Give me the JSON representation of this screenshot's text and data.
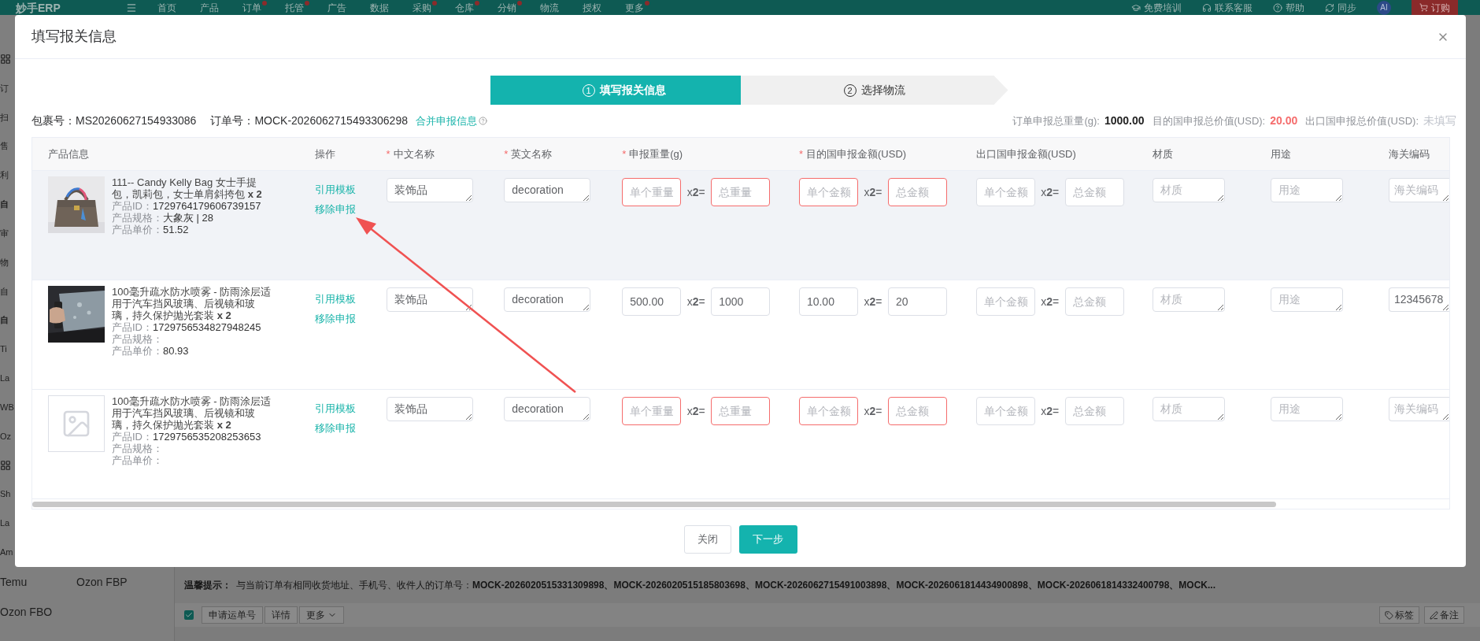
{
  "nav": {
    "logo": "妙手ERP",
    "items": [
      {
        "label": "首页",
        "dot": false
      },
      {
        "label": "产品",
        "dot": false
      },
      {
        "label": "订单",
        "dot": true
      },
      {
        "label": "托管",
        "dot": true
      },
      {
        "label": "广告",
        "dot": false
      },
      {
        "label": "数据",
        "dot": false
      },
      {
        "label": "采购",
        "dot": true
      },
      {
        "label": "仓库",
        "dot": true
      },
      {
        "label": "分销",
        "dot": true
      },
      {
        "label": "物流",
        "dot": false
      },
      {
        "label": "授权",
        "dot": false
      },
      {
        "label": "更多",
        "dot": true
      }
    ],
    "right": [
      "免费培训",
      "联系客服",
      "帮助",
      "同步"
    ],
    "avatar": "AI",
    "order_button": "订购"
  },
  "sidebar": {
    "fragments": [
      {
        "kind": "icon"
      },
      {
        "kind": "text",
        "text": "订",
        "bold": false
      },
      {
        "kind": "text",
        "text": "扫",
        "bold": false
      },
      {
        "kind": "text",
        "text": "售",
        "bold": false
      },
      {
        "kind": "text",
        "text": "利",
        "bold": false
      },
      {
        "kind": "text",
        "text": "自",
        "bold": true
      },
      {
        "kind": "text",
        "text": "审",
        "bold": false
      },
      {
        "kind": "text",
        "text": "物",
        "bold": false
      },
      {
        "kind": "text",
        "text": "自",
        "bold": false
      },
      {
        "kind": "text",
        "text": "自",
        "bold": true
      },
      {
        "kind": "text",
        "text": "Ti",
        "bold": false
      },
      {
        "kind": "text",
        "text": "La",
        "bold": false
      },
      {
        "kind": "text",
        "text": "WB",
        "bold": false
      },
      {
        "kind": "text",
        "text": "Oz",
        "bold": false
      },
      {
        "kind": "icon"
      },
      {
        "kind": "text",
        "text": "Sh",
        "bold": false
      },
      {
        "kind": "text",
        "text": "La",
        "bold": false
      },
      {
        "kind": "text",
        "text": "Am",
        "bold": false
      }
    ],
    "rows": [
      [
        "Temu",
        "Ozon FBP"
      ],
      [
        "Ozon FBO"
      ]
    ]
  },
  "dialog": {
    "title": "填写报关信息",
    "steps": [
      {
        "number": "1",
        "label": "填写报关信息",
        "selected": true
      },
      {
        "number": "2",
        "label": "选择物流",
        "selected": false
      }
    ],
    "package_label": "包裹号：",
    "package_no": "MS20260627154933086",
    "order_label": "订单号：",
    "order_no": "MOCK-2026062715493306298",
    "merge_link": "合并申报信息",
    "totals": [
      {
        "label": "订单申报总重量(g):",
        "value": "1000.00",
        "kind": "strong"
      },
      {
        "label": "目的国申报总价值(USD):",
        "value": "20.00",
        "kind": "alert"
      },
      {
        "label": "出口国申报总价值(USD):",
        "value": "未填写",
        "kind": "muted"
      }
    ],
    "columns": [
      {
        "label": "产品信息"
      },
      {
        "label": "操作"
      },
      {
        "label": "中文名称",
        "required_mark": "*"
      },
      {
        "label": "英文名称",
        "required_mark": "*"
      },
      {
        "label": "申报重量(g)",
        "required_mark": "*"
      },
      {
        "label": "目的国申报金额(USD)",
        "required_mark": "*"
      },
      {
        "label": "出口国申报金额(USD)"
      },
      {
        "label": "材质"
      },
      {
        "label": "用途"
      },
      {
        "label": "海关编码"
      }
    ],
    "rows": [
      {
        "highlighted": true,
        "image": {
          "kind": "picture"
        },
        "title": "111-- Candy Kelly Bag 女士手提包，凯莉包，女士单肩斜挎包 **x 2**",
        "product_id_label": "产品ID：",
        "product_id": "1729764179606739157",
        "spec_label": "产品规格：",
        "spec": "大象灰 | 28",
        "price_label": "产品单价：",
        "price": "51.52",
        "actions": [
          "引用模板",
          "移除申报"
        ],
        "chinese_name": {
          "value": "装饰品"
        },
        "english_name": {
          "value": "decoration"
        },
        "weight": {
          "unit": {
            "placeholder": "单个重量"
          },
          "multiplier": "x**2**=",
          "total": {
            "placeholder": "总重量"
          },
          "invalid": true
        },
        "destination_amount": {
          "unit": {
            "placeholder": "单个金额"
          },
          "multiplier": "x**2**=",
          "total": {
            "placeholder": "总金额"
          },
          "invalid": true
        },
        "export_amount": {
          "unit": {
            "placeholder": "单个金额"
          },
          "multiplier": "x**2**=",
          "total": {
            "placeholder": "总金额"
          },
          "invalid": false
        },
        "material": {
          "placeholder": "材质"
        },
        "usage": {
          "placeholder": "用途"
        },
        "customs_code": {
          "placeholder": "海关编码"
        }
      },
      {
        "highlighted": false,
        "image": {
          "kind": "picture"
        },
        "title": "100毫升疏水防水喷雾 - 防雨涂层适用于汽车挡风玻璃、后视镜和玻璃，持久保护抛光套装 **x 2**",
        "product_id_label": "产品ID：",
        "product_id": "1729756534827948245",
        "spec_label": "产品规格：",
        "price_label": "产品单价：",
        "price": "80.93",
        "actions": [
          "引用模板",
          "移除申报"
        ],
        "chinese_name": {
          "value": "装饰品"
        },
        "english_name": {
          "value": "decoration"
        },
        "weight": {
          "unit": {
            "value": "500.00"
          },
          "multiplier": "x**2**=",
          "total": {
            "value": "1000"
          },
          "invalid": false
        },
        "destination_amount": {
          "unit": {
            "value": "10.00"
          },
          "multiplier": "x**2**=",
          "total": {
            "value": "20"
          },
          "invalid": false
        },
        "export_amount": {
          "unit": {
            "placeholder": "单个金额"
          },
          "multiplier": "x**2**=",
          "total": {
            "placeholder": "总金额"
          },
          "invalid": false
        },
        "material": {
          "placeholder": "材质"
        },
        "usage": {
          "placeholder": "用途"
        },
        "customs_code": {
          "value": "12345678"
        }
      },
      {
        "highlighted": false,
        "image": {
          "kind": "placeholder"
        },
        "title": "100毫升疏水防水喷雾 - 防雨涂层适用于汽车挡风玻璃、后视镜和玻璃，持久保护抛光套装 **x 2**",
        "product_id_label": "产品ID：",
        "product_id": "1729756535208253653",
        "spec_label": "产品规格：",
        "price_label": "产品单价：",
        "actions": [
          "引用模板",
          "移除申报"
        ],
        "chinese_name": {
          "value": "装饰品"
        },
        "english_name": {
          "value": "decoration"
        },
        "weight": {
          "unit": {
            "placeholder": "单个重量"
          },
          "multiplier": "x**2**=",
          "total": {
            "placeholder": "总重量"
          },
          "invalid": true
        },
        "destination_amount": {
          "unit": {
            "placeholder": "单个金额"
          },
          "multiplier": "x**2**=",
          "total": {
            "placeholder": "总金额"
          },
          "invalid": true
        },
        "export_amount": {
          "unit": {
            "placeholder": "单个金额"
          },
          "multiplier": "x**2**=",
          "total": {
            "placeholder": "总金额"
          },
          "invalid": false
        },
        "material": {
          "placeholder": "材质"
        },
        "usage": {
          "placeholder": "用途"
        },
        "customs_code": {
          "placeholder": "海关编码"
        }
      }
    ],
    "footer": {
      "close": "关闭",
      "next": "下一步"
    }
  },
  "background": {
    "hint_label": "温馨提示：",
    "hint": "与当前订单有相同收货地址、手机号、收件人的订单号：**MOCK-2026020515331309898、MOCK-2026020515185803698、MOCK-2026062715491003898、MOCK-2026061814434900898、MOCK-2026061814332400798、MOCK...**",
    "toolbar": {
      "checked": true,
      "buttons": [
        "申请运单号",
        "详情"
      ],
      "more": "更多",
      "right": [
        "标签",
        "备注"
      ]
    }
  }
}
